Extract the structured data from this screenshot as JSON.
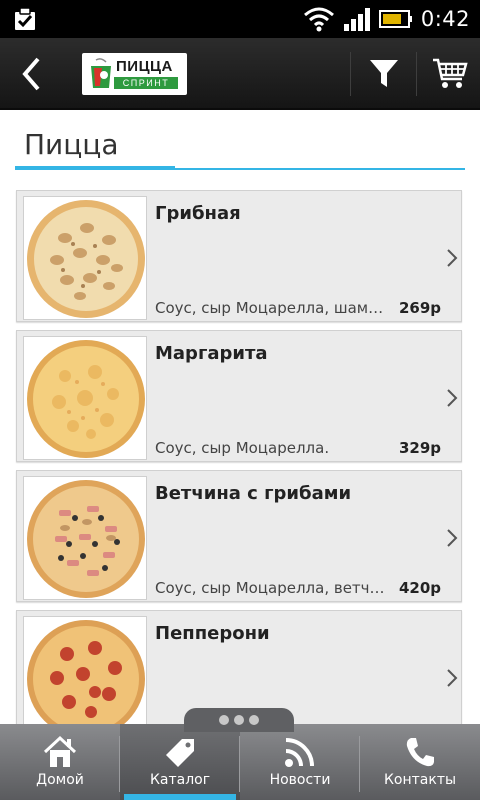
{
  "status_bar": {
    "time": "0:42",
    "icons": [
      "notification-check-icon",
      "wifi-icon",
      "signal-icon",
      "battery-icon"
    ]
  },
  "action_bar": {
    "logo": {
      "title": "ПИЦЦА",
      "subtitle": "СПРИНТ"
    },
    "icons": [
      "back-arrow-icon",
      "filter-icon",
      "cart-icon"
    ]
  },
  "page": {
    "title": "Пицца"
  },
  "products": [
    {
      "name": "Грибная",
      "description": "Соус, сыр Моцарелла, шампиньоны",
      "price": "269р"
    },
    {
      "name": "Маргарита",
      "description": "Соус, сыр Моцарелла.",
      "price": "329р"
    },
    {
      "name": "Ветчина с грибами",
      "description": "Соус, сыр Моцарелла, ветчина",
      "price": "420р"
    },
    {
      "name": "Пепперони",
      "description": "",
      "price": ""
    }
  ],
  "bottom_nav": [
    {
      "label": "Домой",
      "icon": "home-icon",
      "active": false
    },
    {
      "label": "Каталог",
      "icon": "tag-icon",
      "active": true
    },
    {
      "label": "Новости",
      "icon": "rss-icon",
      "active": false
    },
    {
      "label": "Контакты",
      "icon": "phone-icon",
      "active": false
    }
  ],
  "colors": {
    "accent": "#34b5e5",
    "brand_green": "#2e9a3f"
  }
}
